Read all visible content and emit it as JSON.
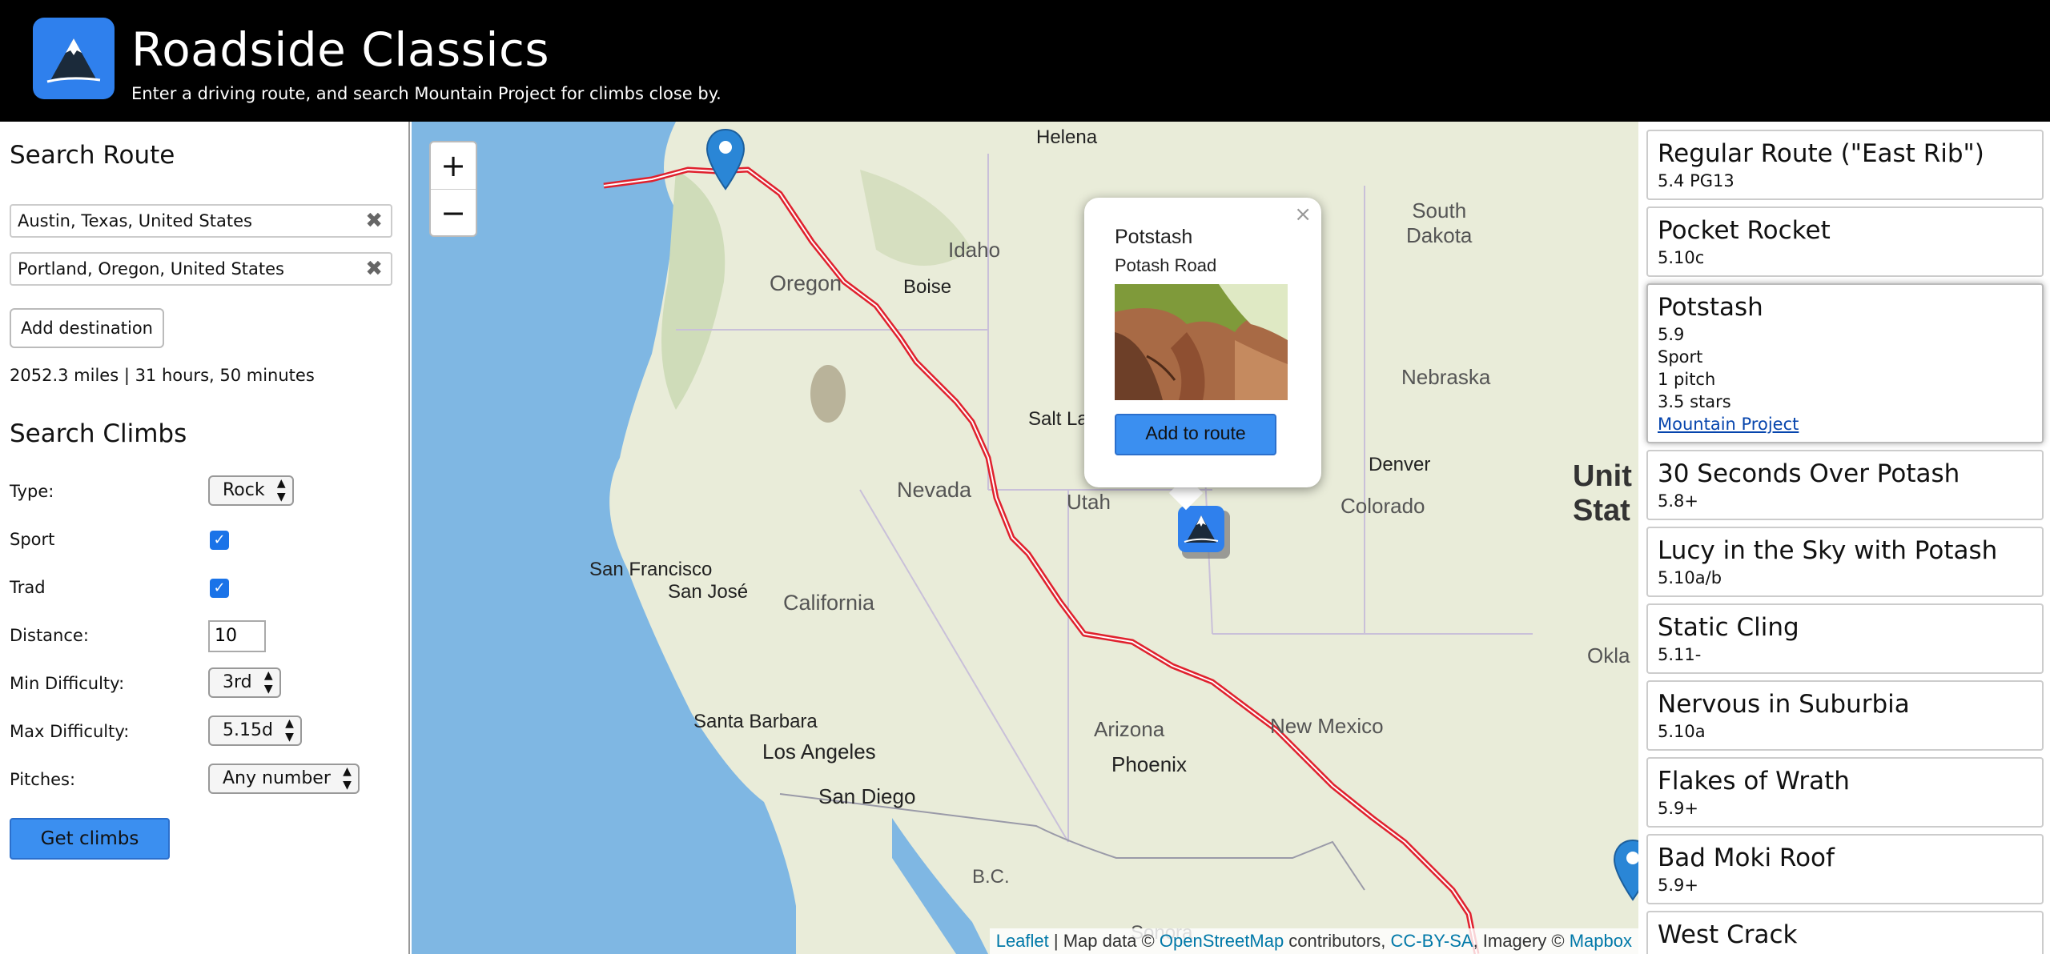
{
  "header": {
    "title": "Roadside Classics",
    "subtitle": "Enter a driving route, and search Mountain Project for climbs close by."
  },
  "sidebar": {
    "search_route_title": "Search Route",
    "route_inputs": [
      "Austin, Texas, United States",
      "Portland, Oregon, United States"
    ],
    "clear_glyph": "✖",
    "add_destination_label": "Add destination",
    "route_summary": "2052.3 miles | 31 hours, 50 minutes",
    "search_climbs_title": "Search Climbs",
    "type_label": "Type:",
    "type_value": "Rock",
    "sport_label": "Sport",
    "sport_checked": true,
    "trad_label": "Trad",
    "trad_checked": true,
    "distance_label": "Distance:",
    "distance_value": "10",
    "min_difficulty_label": "Min Difficulty:",
    "min_difficulty_value": "3rd",
    "max_difficulty_label": "Max Difficulty:",
    "max_difficulty_value": "5.15d",
    "pitches_label": "Pitches:",
    "pitches_value": "Any number",
    "get_climbs_label": "Get climbs"
  },
  "map": {
    "zoom_in": "+",
    "zoom_out": "−",
    "labels": {
      "helena": "Helena",
      "south_dakota": "South\nDakota",
      "idaho": "Idaho",
      "oregon": "Oregon",
      "boise": "Boise",
      "nebraska": "Nebraska",
      "salt_lake": "Salt La",
      "nevada": "Nevada",
      "utah": "Utah",
      "denver": "Denver",
      "colorado": "Colorado",
      "united_states": "Unit\nStat",
      "san_francisco": "San Francisco",
      "san_jose": "San José",
      "california": "California",
      "santa_barbara": "Santa Barbara",
      "los_angeles": "Los Angeles",
      "san_diego": "San Diego",
      "arizona": "Arizona",
      "phoenix": "Phoenix",
      "new_mexico": "New Mexico",
      "bc": "B.C.",
      "sonora": "Sonora",
      "okla": "Okla"
    },
    "popup": {
      "title": "Potstash",
      "subtitle": "Potash Road",
      "add_button": "Add to route",
      "close": "×"
    },
    "attribution": {
      "leaflet": "Leaflet",
      "map_data": " | Map data © ",
      "osm": "OpenStreetMap",
      "contributors": " contributors, ",
      "license": "CC-BY-SA",
      "imagery": ", Imagery © ",
      "mapbox": "Mapbox"
    },
    "colors": {
      "water": "#7fb7e3",
      "land": "#e9ecd9",
      "route": "#e0212e",
      "marker": "#2a86d6"
    }
  },
  "results": [
    {
      "name": "Regular Route (\"East Rib\")",
      "grade": "5.4 PG13"
    },
    {
      "name": "Pocket Rocket",
      "grade": "5.10c"
    },
    {
      "name": "Potstash",
      "grade": "5.9",
      "type": "Sport",
      "pitches": "1 pitch",
      "stars": "3.5 stars",
      "link": "Mountain Project"
    },
    {
      "name": "30 Seconds Over Potash",
      "grade": "5.8+"
    },
    {
      "name": "Lucy in the Sky with Potash",
      "grade": "5.10a/b"
    },
    {
      "name": "Static Cling",
      "grade": "5.11-"
    },
    {
      "name": "Nervous in Suburbia",
      "grade": "5.10a"
    },
    {
      "name": "Flakes of Wrath",
      "grade": "5.9+"
    },
    {
      "name": "Bad Moki Roof",
      "grade": "5.9+"
    },
    {
      "name": "West Crack",
      "grade": ""
    }
  ]
}
